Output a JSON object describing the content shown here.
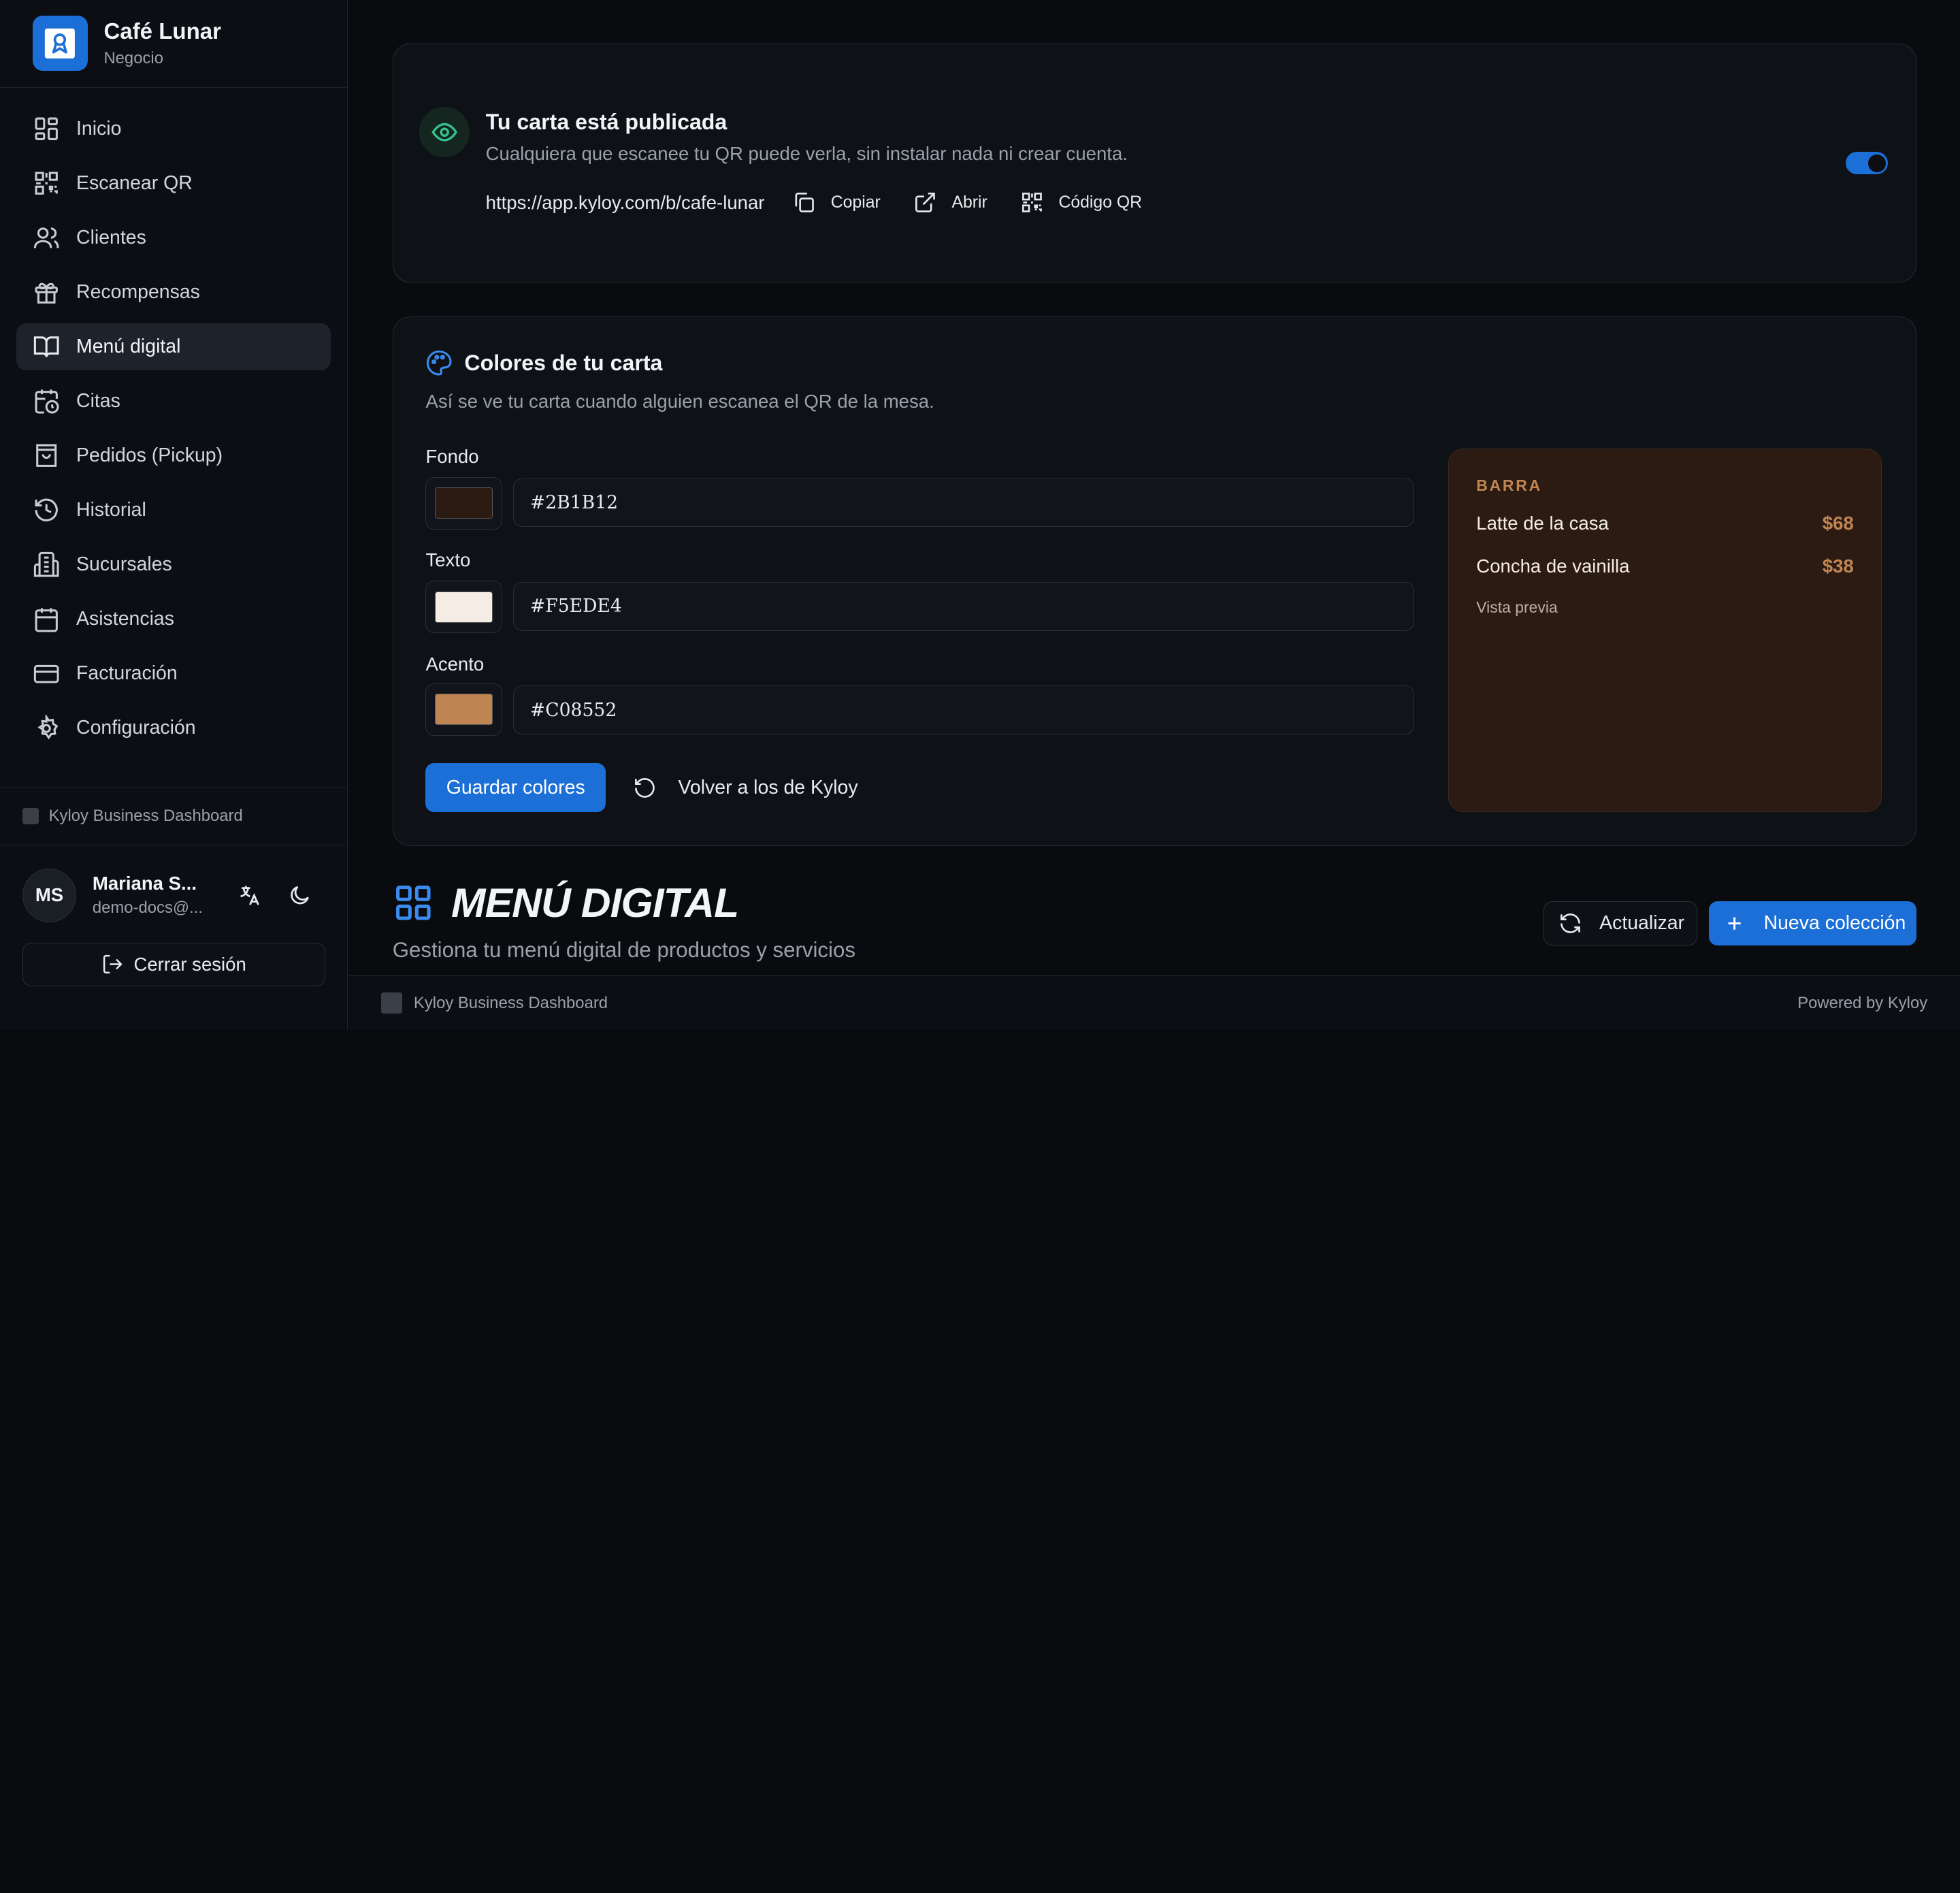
{
  "brand": {
    "name": "Café Lunar",
    "subtitle": "Negocio"
  },
  "sidebar": {
    "items": [
      {
        "label": "Inicio",
        "icon": "dashboard-icon"
      },
      {
        "label": "Escanear QR",
        "icon": "qr-scan-icon"
      },
      {
        "label": "Clientes",
        "icon": "users-icon"
      },
      {
        "label": "Recompensas",
        "icon": "gift-icon"
      },
      {
        "label": "Menú digital",
        "icon": "book-open-icon",
        "active": true
      },
      {
        "label": "Citas",
        "icon": "calendar-clock-icon"
      },
      {
        "label": "Pedidos (Pickup)",
        "icon": "shopping-bag-icon"
      },
      {
        "label": "Historial",
        "icon": "history-icon"
      },
      {
        "label": "Sucursales",
        "icon": "building-icon"
      },
      {
        "label": "Asistencias",
        "icon": "calendar-icon"
      },
      {
        "label": "Facturación",
        "icon": "credit-card-icon"
      },
      {
        "label": "Configuración",
        "icon": "gear-icon"
      }
    ],
    "footer_label": "Kyloy Business Dashboard",
    "user": {
      "initials": "MS",
      "name": "Mariana S...",
      "email": "demo-docs@..."
    },
    "logout_label": "Cerrar sesión"
  },
  "published": {
    "title": "Tu carta está publicada",
    "description": "Cualquiera que escanee tu QR puede verla, sin instalar nada ni crear cuenta.",
    "url": "https://app.kyloy.com/b/cafe-lunar",
    "copy_label": "Copiar",
    "open_label": "Abrir",
    "qr_label": "Código QR",
    "toggle_on": true
  },
  "colors": {
    "title": "Colores de tu carta",
    "description": "Así se ve tu carta cuando alguien escanea el QR de la mesa.",
    "background": {
      "label": "Fondo",
      "value": "#2B1B12"
    },
    "text": {
      "label": "Texto",
      "value": "#F5EDE4"
    },
    "accent": {
      "label": "Acento",
      "value": "#C08552"
    },
    "save_label": "Guardar colores",
    "reset_label": "Volver a los de Kyloy"
  },
  "preview": {
    "section": "BARRA",
    "items": [
      {
        "name": "Latte de la casa",
        "price": "$68"
      },
      {
        "name": "Concha de vainilla",
        "price": "$38"
      }
    ],
    "caption": "Vista previa"
  },
  "page": {
    "title": "MENÚ DIGITAL",
    "subtitle": "Gestiona tu menú digital de productos y servicios",
    "refresh_label": "Actualizar",
    "new_label": "Nueva colección"
  },
  "footer": {
    "left": "Kyloy Business Dashboard",
    "right": "Powered by Kyloy"
  },
  "theme": {
    "accent_blue": "#1C6FD6",
    "success_green": "#34C38F"
  }
}
